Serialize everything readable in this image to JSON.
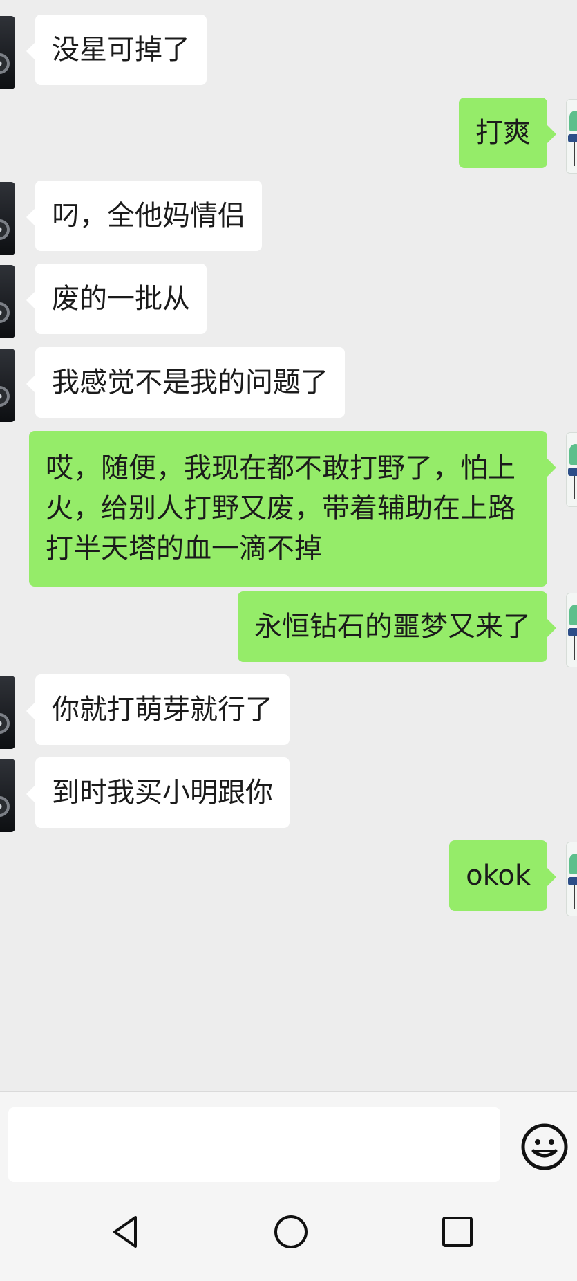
{
  "messages": [
    {
      "sender": "other",
      "text": "没星可掉了"
    },
    {
      "sender": "self",
      "text": "打爽"
    },
    {
      "sender": "other",
      "text": "叼，全他妈情侣"
    },
    {
      "sender": "other",
      "text": "废的一批从"
    },
    {
      "sender": "other",
      "text": "我感觉不是我的问题了"
    },
    {
      "sender": "self",
      "text": "哎，随便，我现在都不敢打野了，怕上火，给别人打野又废，带着辅助在上路打半天塔的血一滴不掉"
    },
    {
      "sender": "self",
      "text": "永恒钻石的噩梦又来了"
    },
    {
      "sender": "other",
      "text": "你就打萌芽就行了"
    },
    {
      "sender": "other",
      "text": "到时我买小明跟你"
    },
    {
      "sender": "self",
      "text": "okok"
    }
  ],
  "composer": {
    "input_value": "",
    "emoji_icon": "emoji-icon"
  },
  "nav": {
    "back_icon": "back-triangle-icon",
    "home_icon": "home-circle-icon",
    "recents_icon": "recents-square-icon"
  },
  "colors": {
    "background": "#ededed",
    "incoming_bubble": "#ffffff",
    "outgoing_bubble": "#95ec69",
    "text": "#1b1b1b"
  }
}
